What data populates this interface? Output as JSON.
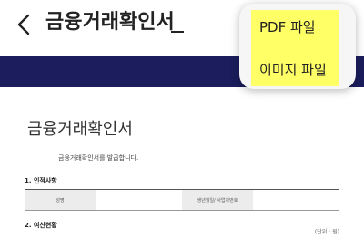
{
  "header": {
    "title": "금융거래확인서"
  },
  "document": {
    "title": "금융거래확인서",
    "intro": "금융거래확인서를 발급합니다.",
    "section1": "1. 인적사항",
    "table_label_1": "성명",
    "table_label_2": "생년월일/ 사업자번호",
    "section2": "2. 여신현황",
    "unit": "(단위 : 원)"
  },
  "popup": {
    "items": [
      "PDF 파일",
      "이미지 파일"
    ]
  },
  "colors": {
    "band": "#1b1d5c",
    "highlight": "#ffff66"
  }
}
